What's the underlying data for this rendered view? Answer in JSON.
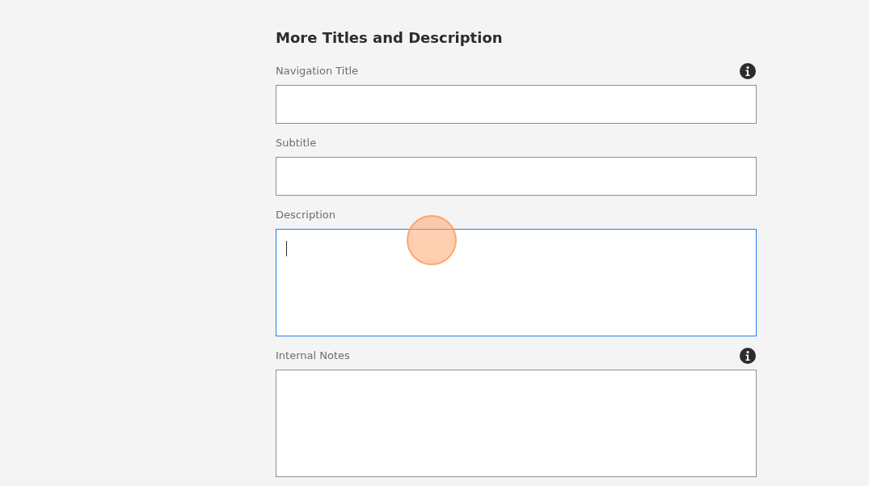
{
  "section": {
    "title": "More Titles and Description"
  },
  "fields": [
    {
      "label": "Navigation Title",
      "kind": "text",
      "info": true,
      "focused": false
    },
    {
      "label": "Subtitle",
      "kind": "text",
      "info": false,
      "focused": false
    },
    {
      "label": "Description",
      "kind": "textarea",
      "info": false,
      "focused": true
    },
    {
      "label": "Internal Notes",
      "kind": "textarea",
      "info": true,
      "focused": false
    }
  ]
}
